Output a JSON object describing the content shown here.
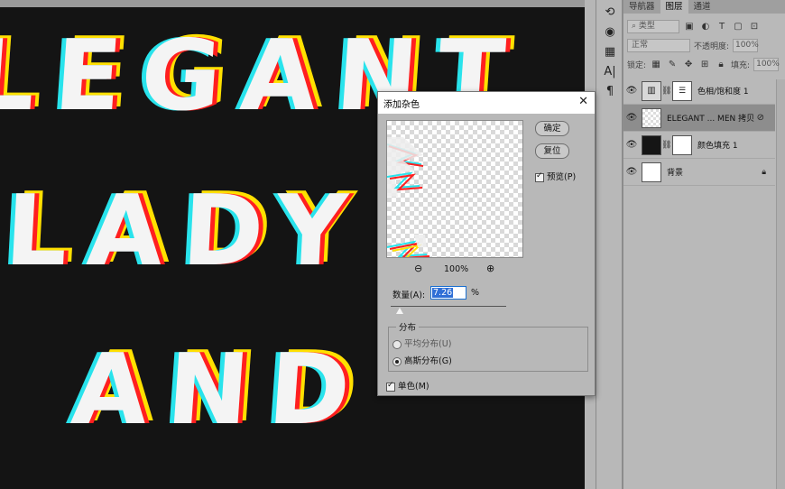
{
  "canvas": {
    "words": [
      "LEGANT",
      "LADY",
      "AND"
    ]
  },
  "panel": {
    "tabs": [
      "导航器",
      "图层",
      "通道"
    ],
    "filter_kind": "类型",
    "blend_mode": "正常",
    "opacity_label": "不透明度:",
    "opacity_value": "100%",
    "lock_label": "锁定:",
    "fill_label": "填充:",
    "fill_value": "100%",
    "layers": [
      {
        "name": "色相/饱和度 1"
      },
      {
        "name": "ELEGANT ... MEN 拷贝"
      },
      {
        "name": "颜色填充 1"
      },
      {
        "name": "背景"
      }
    ]
  },
  "dialog": {
    "title": "添加杂色",
    "ok_label": "确定",
    "reset_label": "复位",
    "preview_label": "预览(P)",
    "zoom_value": "100%",
    "amount_label": "数量(A):",
    "amount_value": "7.26",
    "amount_unit": "%",
    "distribution_label": "分布",
    "uniform_label": "平均分布(U)",
    "gaussian_label": "高斯分布(G)",
    "mono_label": "单色(M)"
  }
}
